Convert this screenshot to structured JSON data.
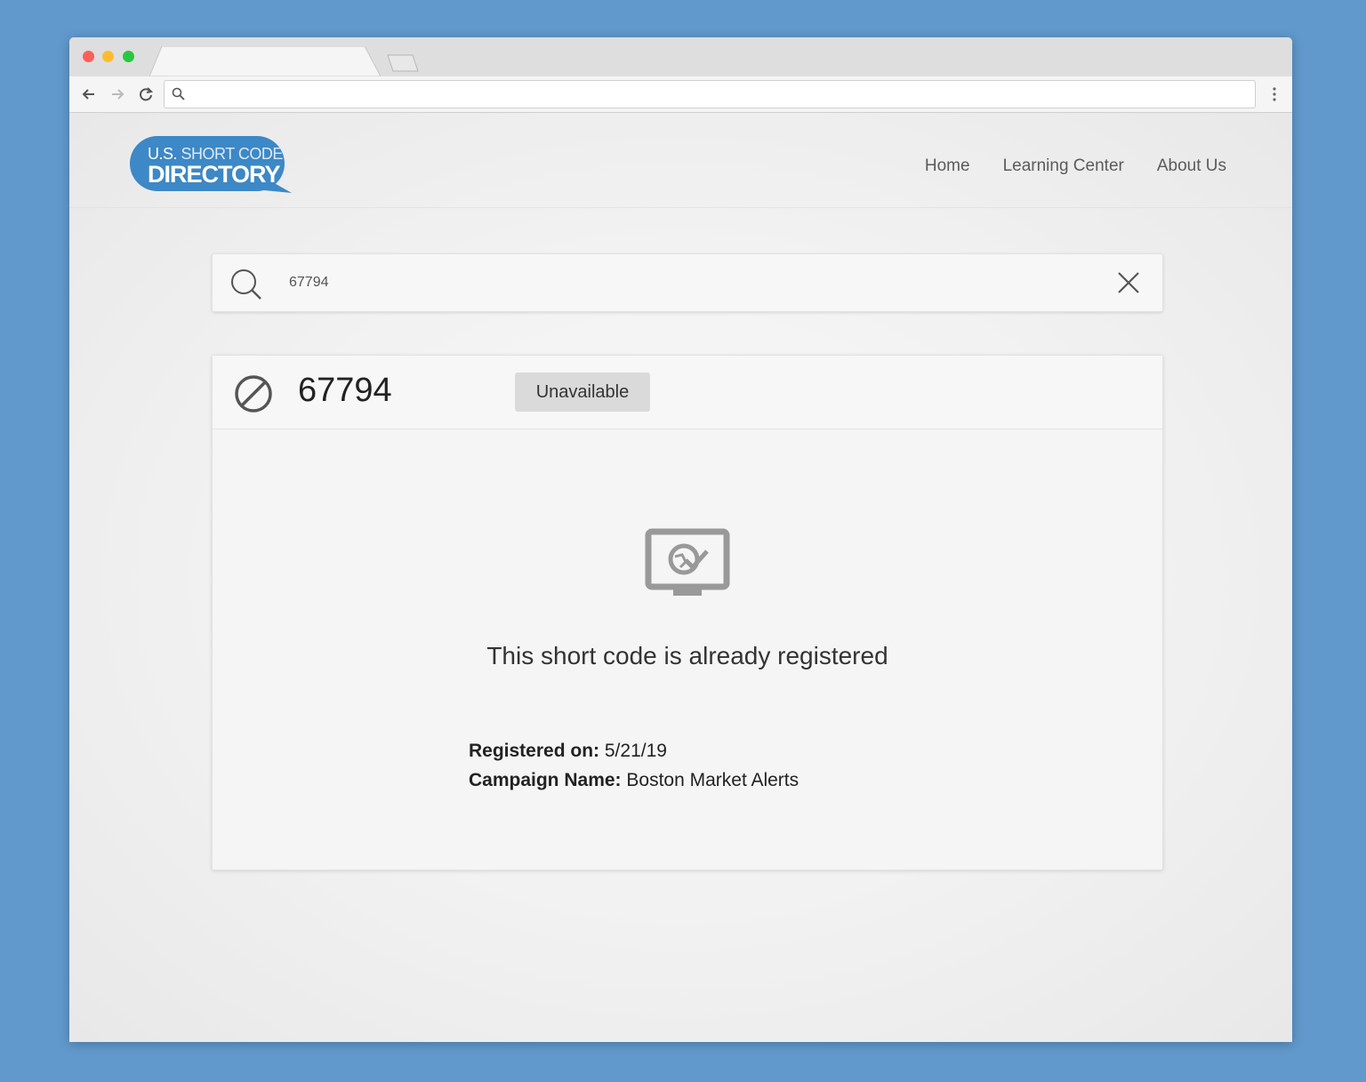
{
  "browser": {
    "address_value": "",
    "icons": [
      "back-arrow-icon",
      "forward-arrow-icon",
      "reload-icon",
      "search-icon",
      "menu-dots-icon"
    ]
  },
  "site": {
    "logo": {
      "line1_prefix": "U.S.",
      "line1_rest": "SHORT CODE",
      "line2": "DIRECTORY"
    },
    "nav": {
      "home": "Home",
      "learning_center": "Learning Center",
      "about_us": "About Us"
    }
  },
  "search": {
    "value": "67794"
  },
  "result": {
    "code": "67794",
    "status_badge": "Unavailable",
    "message": "This short code is already registered",
    "registered_label": "Registered on:",
    "registered_value": "5/21/19",
    "campaign_label": "Campaign Name:",
    "campaign_value": "Boston Market Alerts"
  },
  "colors": {
    "background": "#6199cc",
    "logo_blue": "#3d88c6",
    "badge": "#dadada"
  }
}
